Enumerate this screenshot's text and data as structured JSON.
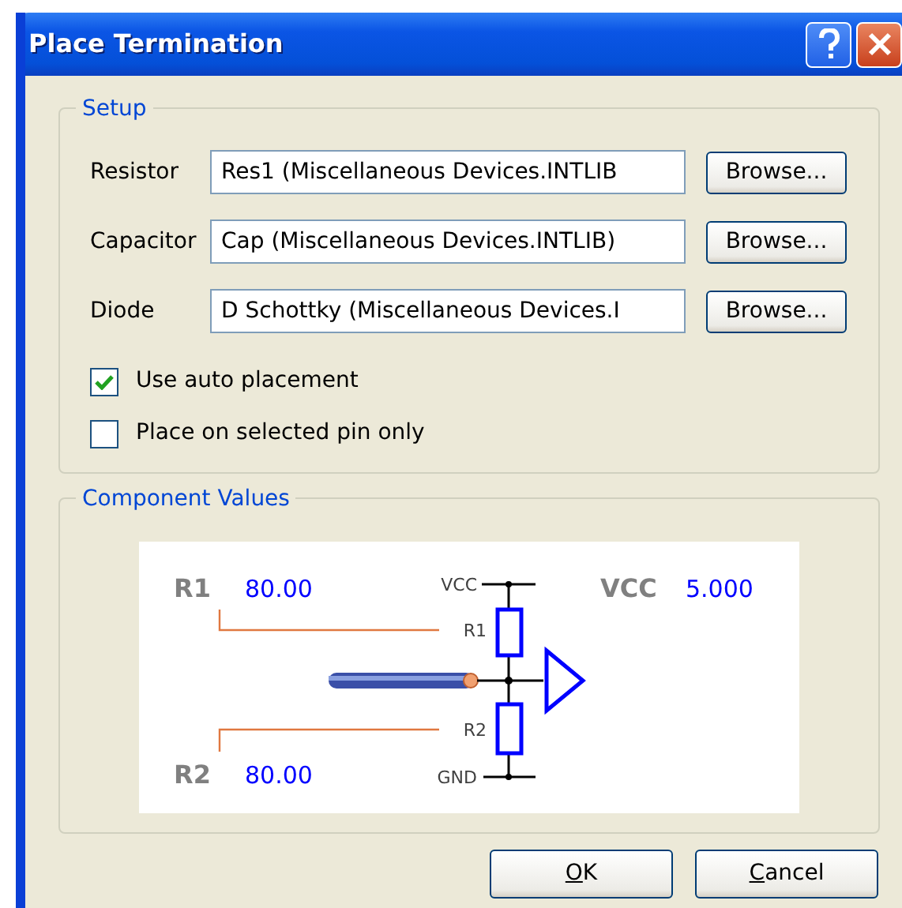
{
  "window": {
    "title": "Place Termination"
  },
  "setup": {
    "title": "Setup",
    "fields": [
      {
        "label": "Resistor",
        "value": "Res1 (Miscellaneous Devices.INTLIB",
        "button": "Browse..."
      },
      {
        "label": "Capacitor",
        "value": "Cap (Miscellaneous Devices.INTLIB)",
        "button": "Browse..."
      },
      {
        "label": "Diode",
        "value": "D Schottky (Miscellaneous Devices.I",
        "button": "Browse..."
      }
    ],
    "options": [
      {
        "label": "Use auto placement",
        "checked": true
      },
      {
        "label": "Place on selected pin only",
        "checked": false
      }
    ]
  },
  "component_values": {
    "title": "Component Values",
    "r1": {
      "label": "R1",
      "value": "80.00"
    },
    "r2": {
      "label": "R2",
      "value": "80.00"
    },
    "vcc": {
      "label": "VCC",
      "value": "5.000"
    },
    "pins": {
      "top": "VCC",
      "upper": "R1",
      "lower": "R2",
      "bottom": "GND"
    }
  },
  "buttons": [
    "OK",
    "Cancel"
  ]
}
